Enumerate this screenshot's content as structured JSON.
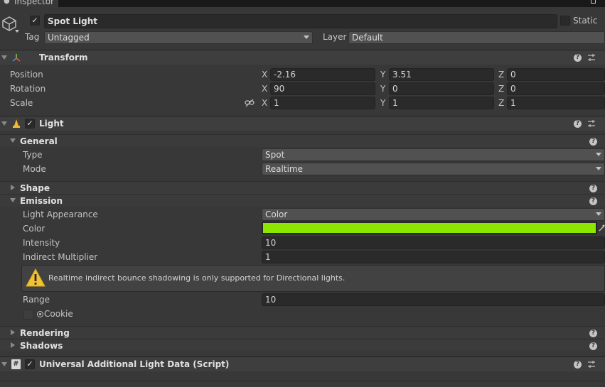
{
  "window": {
    "tab_label": "Inspector"
  },
  "object": {
    "name": "Spot Light",
    "static_label": "Static",
    "tag_label": "Tag",
    "tag_value": "Untagged",
    "layer_label": "Layer",
    "layer_value": "Default"
  },
  "transform": {
    "title": "Transform",
    "position": {
      "label": "Position",
      "x": "-2.16",
      "y": "3.51",
      "z": "0"
    },
    "rotation": {
      "label": "Rotation",
      "x": "90",
      "y": "0",
      "z": "0"
    },
    "scale": {
      "label": "Scale",
      "x": "1",
      "y": "1",
      "z": "1"
    },
    "axes": {
      "x": "X",
      "y": "Y",
      "z": "Z"
    }
  },
  "light": {
    "title": "Light",
    "general": {
      "title": "General",
      "type_label": "Type",
      "type_value": "Spot",
      "mode_label": "Mode",
      "mode_value": "Realtime"
    },
    "shape": {
      "title": "Shape"
    },
    "emission": {
      "title": "Emission",
      "appearance_label": "Light Appearance",
      "appearance_value": "Color",
      "color_label": "Color",
      "color_value": "#8ce600",
      "intensity_label": "Intensity",
      "intensity_value": "10",
      "indirect_label": "Indirect Multiplier",
      "indirect_value": "1",
      "warning": "Realtime indirect bounce shadowing is only supported for Directional lights.",
      "range_label": "Range",
      "range_value": "10",
      "cookie_label": "Cookie"
    },
    "rendering": {
      "title": "Rendering"
    },
    "shadows": {
      "title": "Shadows"
    }
  },
  "uald": {
    "title": "Universal Additional Light Data (Script)"
  }
}
